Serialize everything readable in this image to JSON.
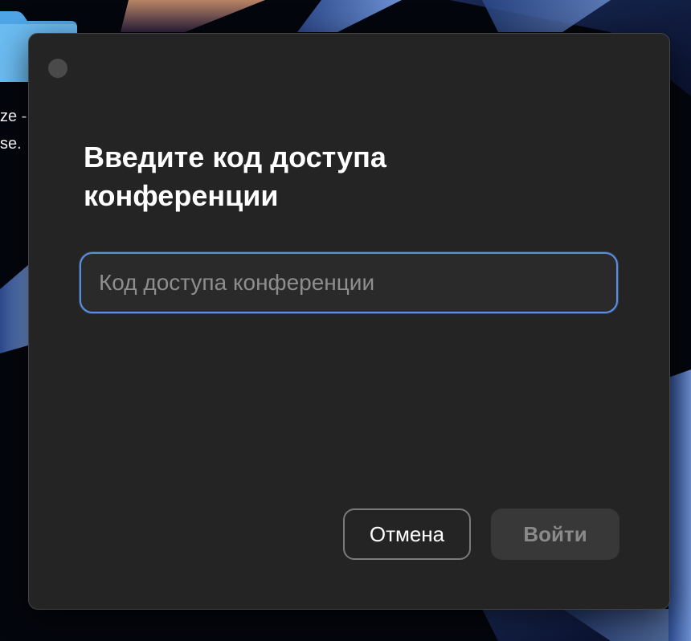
{
  "desktop": {
    "label_line_1": "ze -",
    "label_line_2": "se.",
    "folder_color": "#5aaee8"
  },
  "dialog": {
    "title": "Введите код доступа конференции",
    "input": {
      "value": "",
      "placeholder": "Код доступа конференции"
    },
    "buttons": {
      "cancel_label": "Отмена",
      "join_label": "Войти"
    },
    "accent_color": "#5a8fe0"
  }
}
